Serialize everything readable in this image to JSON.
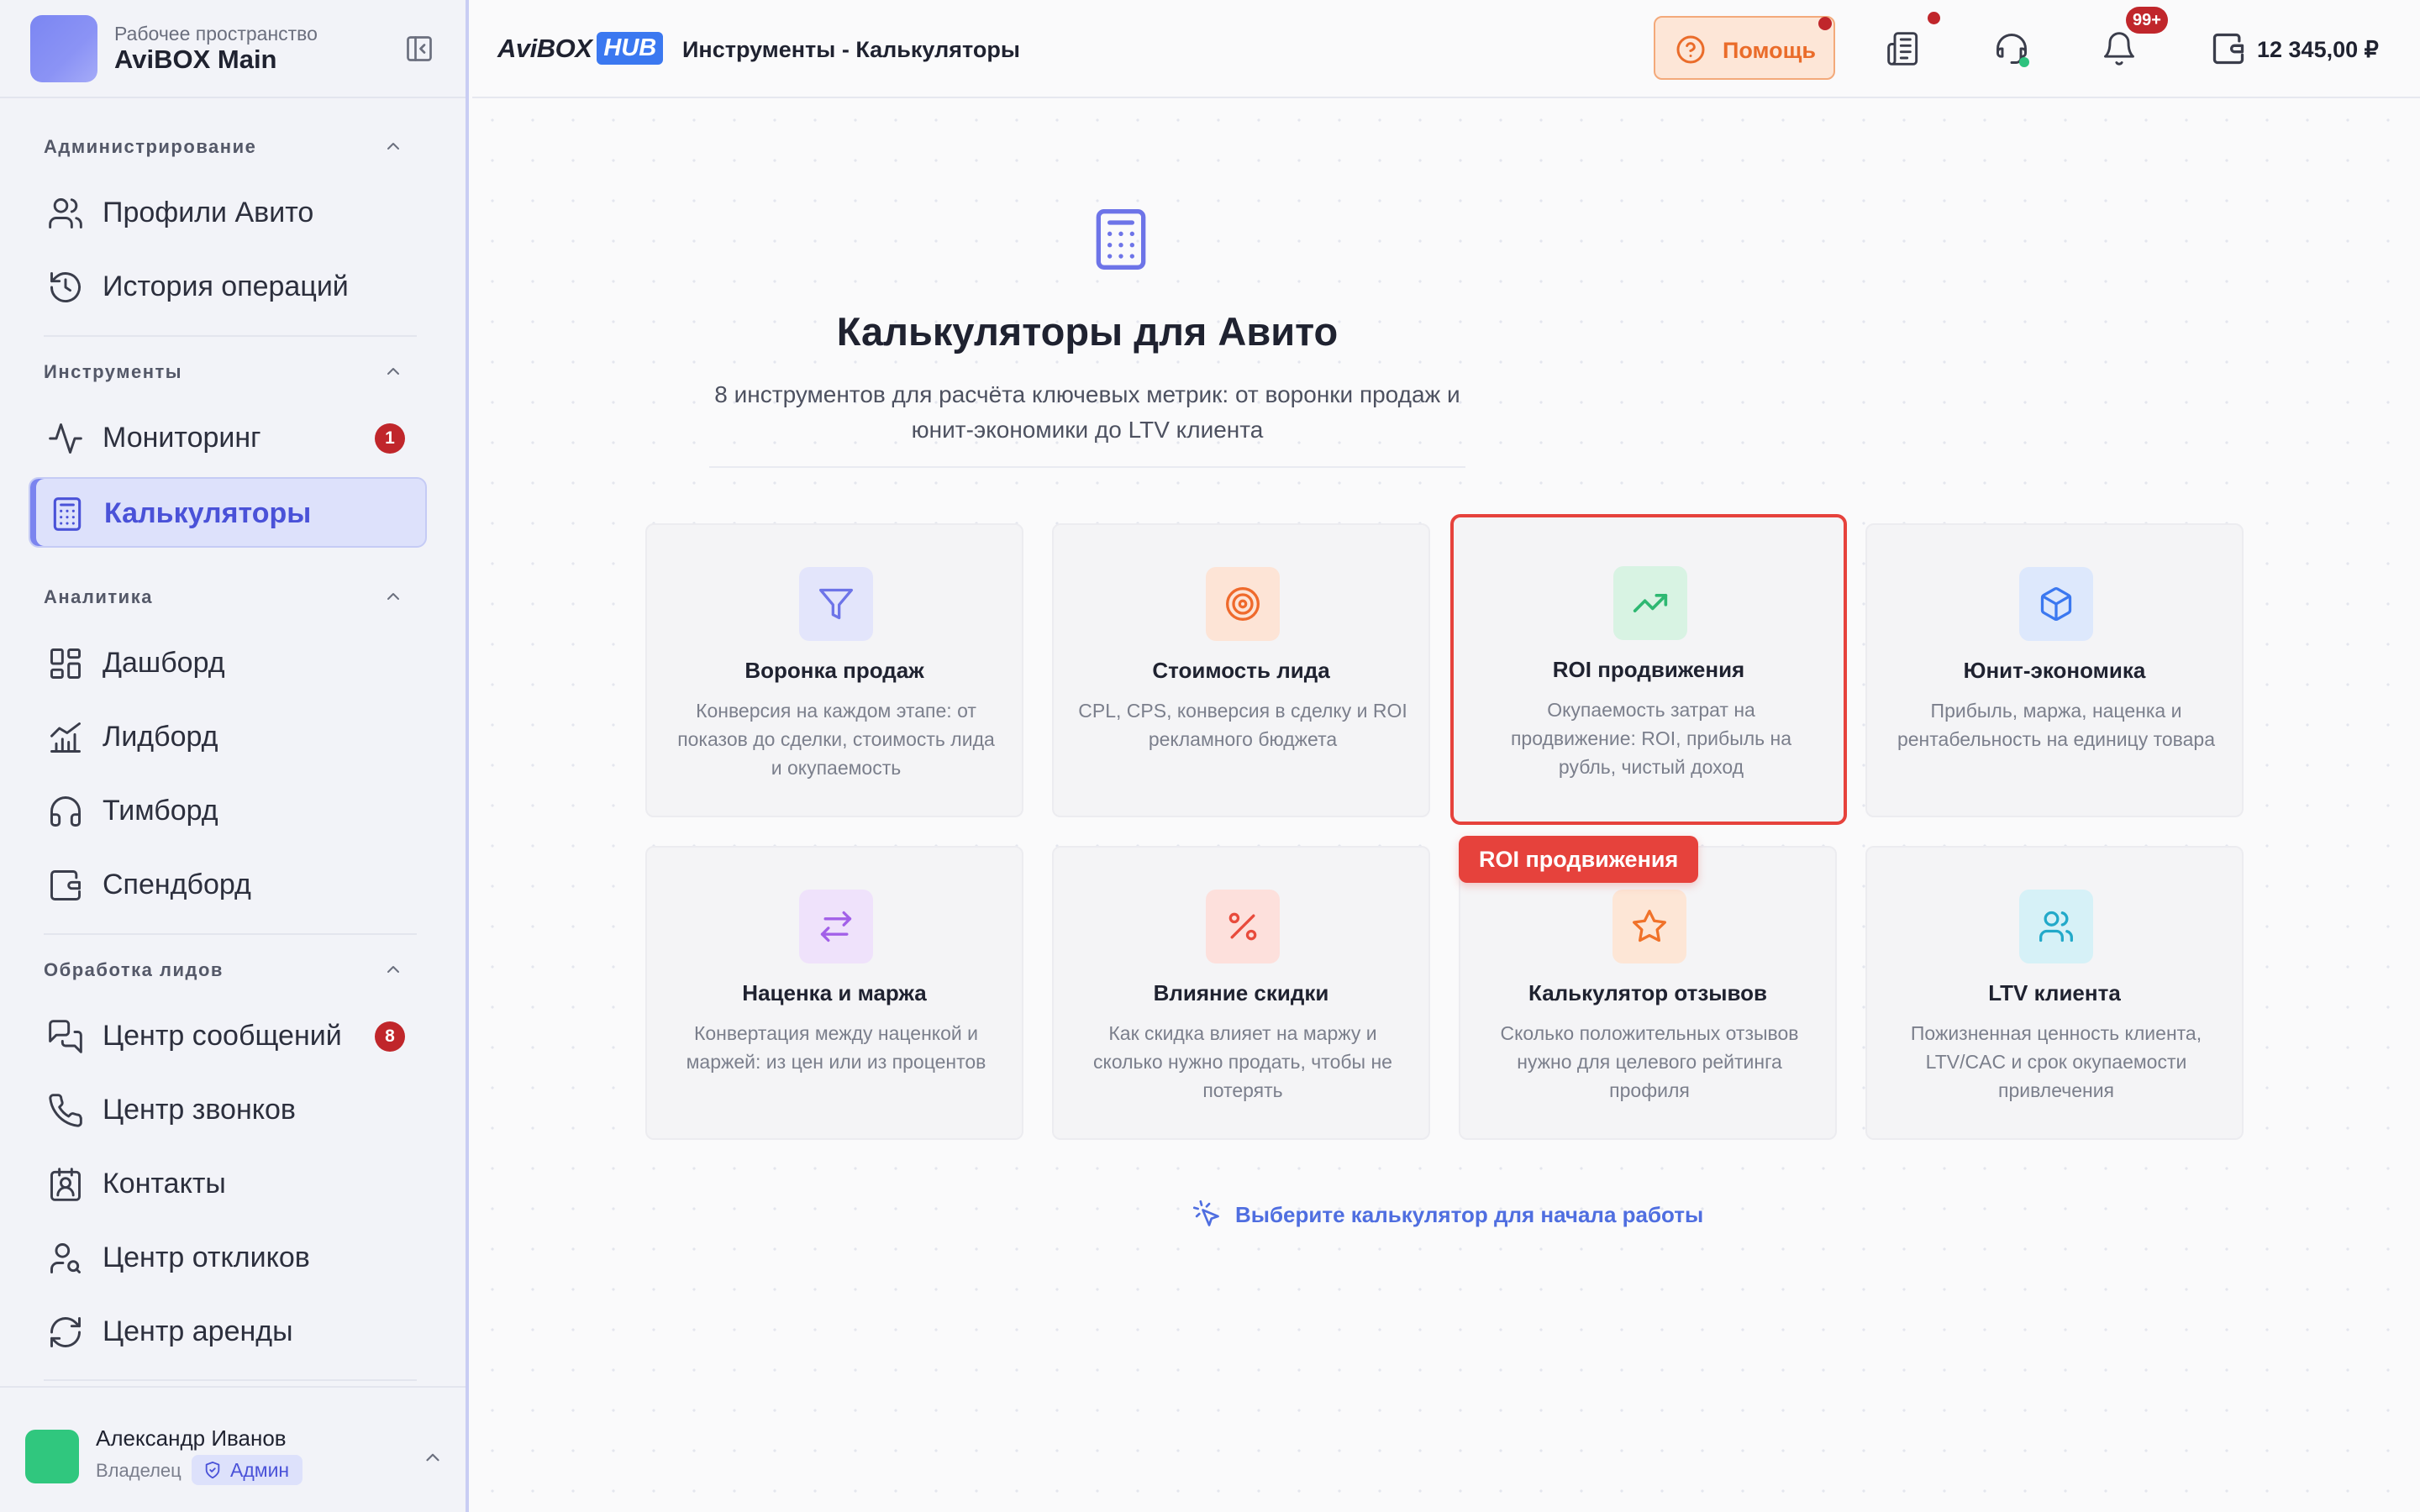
{
  "workspace": {
    "subtitle": "Рабочее пространство",
    "name": "AviBOX Main"
  },
  "sidebar": {
    "sections": [
      {
        "title": "Администрирование",
        "items": [
          {
            "label": "Профили Авито",
            "icon": "users-icon"
          },
          {
            "label": "История операций",
            "icon": "history-icon"
          }
        ]
      },
      {
        "title": "Инструменты",
        "items": [
          {
            "label": "Мониторинг",
            "icon": "activity-icon",
            "badge": "1"
          },
          {
            "label": "Калькуляторы",
            "icon": "calculator-icon",
            "active": true
          }
        ]
      },
      {
        "title": "Аналитика",
        "items": [
          {
            "label": "Дашборд",
            "icon": "dashboard-icon"
          },
          {
            "label": "Лидборд",
            "icon": "chart-icon"
          },
          {
            "label": "Тимборд",
            "icon": "headphones-icon"
          },
          {
            "label": "Спендборд",
            "icon": "wallet-icon"
          }
        ]
      },
      {
        "title": "Обработка лидов",
        "items": [
          {
            "label": "Центр сообщений",
            "icon": "messages-icon",
            "badge": "8"
          },
          {
            "label": "Центр звонков",
            "icon": "phone-icon"
          },
          {
            "label": "Контакты",
            "icon": "contacts-icon"
          },
          {
            "label": "Центр откликов",
            "icon": "user-search-icon"
          },
          {
            "label": "Центр аренды",
            "icon": "refresh-icon"
          }
        ]
      }
    ]
  },
  "user": {
    "name": "Александр Иванов",
    "role": "Владелец",
    "badge": "Админ"
  },
  "header": {
    "brand_left": "AviBOX",
    "brand_right": "HUB",
    "path": "Инструменты - Калькуляторы",
    "help_label": "Помощь",
    "notifications_badge": "99+",
    "balance": "12 345,00 ₽"
  },
  "hero": {
    "title": "Калькуляторы для Авито",
    "description_line1": "8 инструментов для расчёта ключевых метрик: от воронки продаж и",
    "description_line2": "юнит-экономики до LTV клиента"
  },
  "cards": [
    {
      "title": "Воронка продаж",
      "desc": "Конверсия на каждом этапе: от показов до сделки, стоимость лида и окупаемость",
      "icon": "funnel-icon",
      "color": "#6d74e8",
      "bg": "#e3e5fb"
    },
    {
      "title": "Стоимость лида",
      "desc": "CPL, CPS, конверсия в сделку и ROI рекламного бюджета",
      "icon": "target-icon",
      "color": "#ef6a2c",
      "bg": "#fde4d6"
    },
    {
      "title": "ROI продвижения",
      "desc": "Окупаемость затрат на продвижение: ROI, прибыль на рубль, чистый доход",
      "icon": "trending-up-icon",
      "color": "#2eb872",
      "bg": "#d8f3e3"
    },
    {
      "title": "Юнит-экономика",
      "desc": "Прибыль, маржа, наценка и рентабельность на единицу товара",
      "icon": "box-icon",
      "color": "#3b78f0",
      "bg": "#dde8fc"
    },
    {
      "title": "Наценка и маржа",
      "desc": "Конвертация между наценкой и маржей: из цен или из процентов",
      "icon": "arrows-icon",
      "color": "#a260e8",
      "bg": "#efe2fb"
    },
    {
      "title": "Влияние скидки",
      "desc": "Как скидка влияет на маржу и сколько нужно продать, чтобы не потерять",
      "icon": "percent-icon",
      "color": "#e84b3c",
      "bg": "#fde0dc"
    },
    {
      "title": "Калькулятор отзывов",
      "desc": "Сколько положительных отзывов нужно для целевого рейтинга профиля",
      "icon": "star-icon",
      "color": "#f0722a",
      "bg": "#fde6d6"
    },
    {
      "title": "LTV клиента",
      "desc": "Пожизненная ценность клиента, LTV/CAC и срок окупаемости привлечения",
      "icon": "users-icon",
      "color": "#22a9c9",
      "bg": "#d6f1f7"
    }
  ],
  "tooltip": "ROI продвижения",
  "hint": "Выберите калькулятор для начала работы",
  "colors": {
    "accent": "#4a52d8",
    "selection": "#e6423c",
    "badge": "#c0262b",
    "help": "#ea6c2a"
  }
}
